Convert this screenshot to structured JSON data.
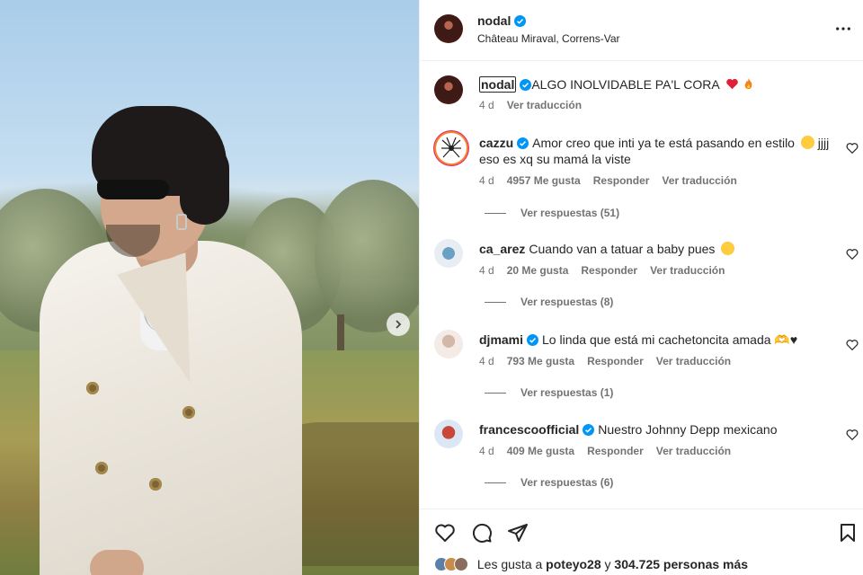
{
  "post": {
    "username": "nodal",
    "location": "Château Miraval, Correns-Var"
  },
  "caption": {
    "username": "nodal",
    "text": "ALGO INOLVIDABLE PA'L CORA",
    "time": "4 d",
    "translate": "Ver traducción"
  },
  "comments": [
    {
      "username": "cazzu",
      "verified": true,
      "text": "Amor creo que inti ya te está pasando en estilo",
      "text_tail": "jjjj eso es xq su mamá la viste",
      "time": "4 d",
      "likes": "4957 Me gusta",
      "reply": "Responder",
      "translate": "Ver traducción",
      "view_replies": "Ver respuestas (51)"
    },
    {
      "username": "ca_arez",
      "verified": false,
      "text": "Cuando van a tatuar a baby pues",
      "time": "4 d",
      "likes": "20 Me gusta",
      "reply": "Responder",
      "translate": "Ver traducción",
      "view_replies": "Ver respuestas (8)"
    },
    {
      "username": "djmami",
      "verified": true,
      "text": "Lo linda que está mi cachetoncita amada 🫶♥",
      "time": "4 d",
      "likes": "793 Me gusta",
      "reply": "Responder",
      "translate": "Ver traducción",
      "view_replies": "Ver respuestas (1)"
    },
    {
      "username": "francescoofficial",
      "verified": true,
      "text": "Nuestro Johnny Depp mexicano",
      "time": "4 d",
      "likes": "409 Me gusta",
      "reply": "Responder",
      "translate": "Ver traducción",
      "view_replies": "Ver respuestas (6)"
    }
  ],
  "likes_bar": {
    "prefix": "Les gusta a",
    "user": "poteyo28",
    "joiner": "y",
    "others": "304.725 personas más"
  },
  "colors": {
    "verified": "#0095f6",
    "text": "#262626",
    "muted": "#737373",
    "border": "#efefef"
  }
}
